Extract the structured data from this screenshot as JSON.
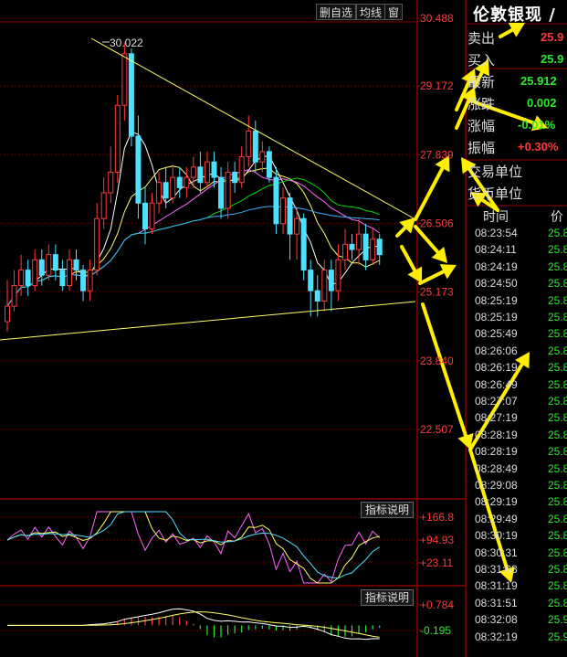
{
  "toolbar": {
    "btn1": "删自选",
    "btn2": "均线",
    "btn3": "窗"
  },
  "main_axis": {
    "labels": [
      "30.488",
      "29.172",
      "27.839",
      "26.506",
      "25.173",
      "23.840",
      "22.507"
    ]
  },
  "max_label": "30.022",
  "indicator1": {
    "button": "指标说明",
    "labels": [
      "+166.8",
      "+94.93",
      "+23.11"
    ]
  },
  "indicator2": {
    "button": "指标说明",
    "labels": [
      "+0.784",
      "-0.195"
    ]
  },
  "quote": {
    "title": "伦敦银现",
    "title_tail": "/",
    "ask_label": "卖出",
    "ask_value": "25.9",
    "bid_label": "买入",
    "bid_value": "25.9",
    "last_label": "最新",
    "last_value": "25.912",
    "change_label": "涨跌",
    "change_value": "0.002",
    "pct_label": "涨幅",
    "pct_value": "-0.01%",
    "amp_label": "振幅",
    "amp_value": "+0.30%",
    "unit_label": "交易单位",
    "currency_label": "货币单位"
  },
  "ticks": {
    "time_header": "时间",
    "price_header": "价",
    "rows": [
      {
        "time": "08:23:54",
        "price": "25.8"
      },
      {
        "time": "08:24:11",
        "price": "25.8"
      },
      {
        "time": "08:24:19",
        "price": "25.8"
      },
      {
        "time": "08:24:50",
        "price": "25.8"
      },
      {
        "time": "08:25:19",
        "price": "25.8"
      },
      {
        "time": "08:25:19",
        "price": "25.8"
      },
      {
        "time": "08:25:49",
        "price": "25.8"
      },
      {
        "time": "08:26:06",
        "price": "25.8"
      },
      {
        "time": "08:26:19",
        "price": "25.8"
      },
      {
        "time": "08:26:49",
        "price": "25.8"
      },
      {
        "time": "08:27:07",
        "price": "25.8"
      },
      {
        "time": "08:27:19",
        "price": "25.8"
      },
      {
        "time": "08:28:19",
        "price": "25.8"
      },
      {
        "time": "08:28:19",
        "price": "25.8"
      },
      {
        "time": "08:28:49",
        "price": "25.8"
      },
      {
        "time": "08:29:08",
        "price": "25.8"
      },
      {
        "time": "08:29:19",
        "price": "25.8"
      },
      {
        "time": "08:29:49",
        "price": "25.8"
      },
      {
        "time": "08:30:19",
        "price": "25.8"
      },
      {
        "time": "08:30:31",
        "price": "25.8"
      },
      {
        "time": "08:31:08",
        "price": "25.8"
      },
      {
        "time": "08:31:19",
        "price": "25.8"
      },
      {
        "time": "08:31:51",
        "price": "25.8"
      },
      {
        "time": "08:32:08",
        "price": "25.9"
      },
      {
        "time": "08:32:19",
        "price": "25.9"
      }
    ]
  },
  "colors": {
    "up": "#ff3a3a",
    "down": "#4ee0ff",
    "grid_red": "#8b0000",
    "ma5": "#ffffff",
    "ma10": "#ffff66",
    "ma20": "#ff66ff",
    "ma60": "#00dd00",
    "trend": "#ffff66",
    "arrow": "#ffee00"
  },
  "chart_data": {
    "type": "candlestick",
    "ylim": [
      21.5,
      30.6
    ],
    "candles": [
      [
        24.6,
        24.9,
        24.4,
        25.4
      ],
      [
        24.9,
        25.3,
        24.8,
        25.6
      ],
      [
        25.3,
        25.6,
        25.1,
        25.9
      ],
      [
        25.6,
        25.3,
        25.1,
        25.8
      ],
      [
        25.3,
        25.8,
        25.2,
        26.0
      ],
      [
        25.8,
        25.5,
        25.3,
        26.0
      ],
      [
        25.5,
        25.9,
        25.4,
        26.1
      ],
      [
        25.9,
        25.6,
        25.4,
        26.1
      ],
      [
        25.6,
        25.3,
        25.2,
        25.8
      ],
      [
        25.3,
        25.8,
        25.2,
        26.0
      ],
      [
        25.8,
        25.6,
        25.4,
        26.0
      ],
      [
        25.6,
        25.2,
        25.0,
        25.7
      ],
      [
        25.2,
        25.6,
        25.0,
        25.8
      ],
      [
        25.6,
        26.6,
        25.5,
        26.9
      ],
      [
        26.6,
        27.1,
        26.4,
        27.4
      ],
      [
        27.1,
        27.5,
        26.9,
        28.0
      ],
      [
        27.5,
        28.8,
        27.3,
        29.0
      ],
      [
        28.8,
        29.8,
        28.5,
        30.022
      ],
      [
        29.8,
        28.2,
        28.0,
        29.9
      ],
      [
        28.2,
        26.9,
        26.6,
        28.6
      ],
      [
        26.9,
        26.4,
        26.1,
        27.2
      ],
      [
        26.4,
        26.9,
        26.3,
        27.1
      ],
      [
        26.9,
        27.3,
        26.7,
        27.5
      ],
      [
        27.3,
        27.0,
        26.8,
        27.6
      ],
      [
        27.0,
        27.4,
        26.9,
        27.6
      ],
      [
        27.4,
        27.2,
        27.0,
        27.6
      ],
      [
        27.2,
        27.4,
        27.0,
        27.6
      ],
      [
        27.4,
        27.6,
        27.2,
        27.8
      ],
      [
        27.6,
        27.3,
        27.1,
        27.9
      ],
      [
        27.3,
        27.7,
        27.2,
        27.9
      ],
      [
        27.7,
        27.4,
        27.2,
        27.9
      ],
      [
        27.4,
        26.8,
        26.6,
        27.6
      ],
      [
        26.8,
        27.5,
        26.6,
        27.7
      ],
      [
        27.5,
        27.3,
        27.1,
        27.7
      ],
      [
        27.3,
        27.8,
        27.2,
        28.0
      ],
      [
        27.8,
        28.3,
        27.6,
        28.6
      ],
      [
        28.3,
        27.7,
        27.5,
        28.5
      ],
      [
        27.7,
        27.9,
        27.5,
        28.1
      ],
      [
        27.9,
        27.4,
        27.3,
        28.0
      ],
      [
        27.4,
        26.5,
        26.3,
        27.6
      ],
      [
        26.5,
        27.0,
        26.3,
        27.2
      ],
      [
        27.0,
        26.3,
        25.8,
        27.1
      ],
      [
        26.3,
        26.6,
        25.8,
        26.8
      ],
      [
        26.6,
        25.6,
        25.4,
        26.7
      ],
      [
        25.6,
        25.2,
        24.7,
        25.8
      ],
      [
        25.2,
        25.0,
        24.7,
        25.5
      ],
      [
        25.0,
        25.6,
        24.8,
        25.8
      ],
      [
        25.6,
        25.2,
        24.8,
        25.8
      ],
      [
        25.2,
        25.8,
        25.0,
        26.1
      ],
      [
        25.8,
        26.1,
        25.6,
        26.4
      ],
      [
        26.1,
        26.0,
        25.8,
        26.3
      ],
      [
        26.0,
        26.3,
        25.7,
        26.6
      ],
      [
        26.3,
        25.8,
        25.6,
        26.5
      ],
      [
        25.8,
        26.2,
        25.7,
        26.4
      ],
      [
        26.2,
        25.9,
        25.7,
        26.3
      ]
    ]
  }
}
